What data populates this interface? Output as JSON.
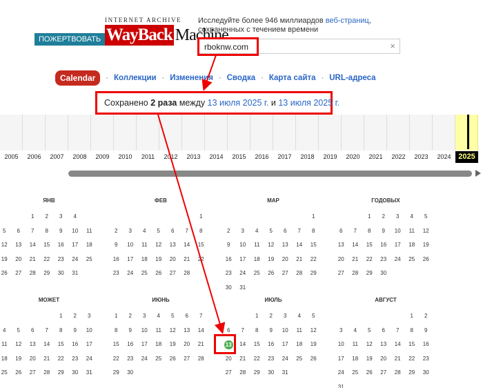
{
  "header": {
    "donate_label": "ПОЖЕРТВОВАТЬ",
    "logo_top": "INTERNET ARCHIVE",
    "logo_way": "WayBack",
    "logo_machine": "Machine",
    "tagline_pre": "Исследуйте более 946 миллиардов ",
    "tagline_link": "веб-страниц",
    "tagline_post": ", сохраненных с течением времени",
    "search_value": "rboknw.com",
    "clear_icon": "×"
  },
  "nav": {
    "calendar": "Calendar",
    "items": [
      "Коллекции",
      "Изменения",
      "Сводка",
      "Карта сайта",
      "URL-адреса"
    ],
    "separator": "·"
  },
  "saved": {
    "prefix": "Сохранено ",
    "count": "2 раза",
    "between": " между ",
    "date_from": "13 июля 2025 г.",
    "and": " и ",
    "date_to": "13 июля 2025 г."
  },
  "timeline": {
    "years": [
      "2005",
      "2006",
      "2007",
      "2008",
      "2009",
      "2010",
      "2011",
      "2012",
      "2013",
      "2014",
      "2015",
      "2016",
      "2017",
      "2018",
      "2019",
      "2020",
      "2021",
      "2022",
      "2023",
      "2024",
      "2025"
    ],
    "current_year": "2025"
  },
  "calendar": {
    "months": [
      {
        "name": "ЯНВ",
        "weeks": [
          [
            "",
            "",
            "1",
            "2",
            "3",
            "4",
            ""
          ],
          [
            "5",
            "6",
            "7",
            "8",
            "9",
            "10",
            "11"
          ],
          [
            "12",
            "13",
            "14",
            "15",
            "16",
            "17",
            "18"
          ],
          [
            "19",
            "20",
            "21",
            "22",
            "23",
            "24",
            "25"
          ],
          [
            "26",
            "27",
            "28",
            "29",
            "30",
            "31",
            ""
          ]
        ]
      },
      {
        "name": "ФЕВ",
        "weeks": [
          [
            "",
            "",
            "",
            "",
            "",
            "",
            "1"
          ],
          [
            "2",
            "3",
            "4",
            "5",
            "6",
            "7",
            "8"
          ],
          [
            "9",
            "10",
            "11",
            "12",
            "13",
            "14",
            "15"
          ],
          [
            "16",
            "17",
            "18",
            "19",
            "20",
            "21",
            "22"
          ],
          [
            "23",
            "24",
            "25",
            "26",
            "27",
            "28",
            ""
          ]
        ]
      },
      {
        "name": "МАР",
        "weeks": [
          [
            "",
            "",
            "",
            "",
            "",
            "",
            "1"
          ],
          [
            "2",
            "3",
            "4",
            "5",
            "6",
            "7",
            "8"
          ],
          [
            "9",
            "10",
            "11",
            "12",
            "13",
            "14",
            "15"
          ],
          [
            "16",
            "17",
            "18",
            "19",
            "20",
            "21",
            "22"
          ],
          [
            "23",
            "24",
            "25",
            "26",
            "27",
            "28",
            "29"
          ],
          [
            "30",
            "31",
            "",
            "",
            "",
            "",
            ""
          ]
        ]
      },
      {
        "name": "ГОДОВЫХ",
        "weeks": [
          [
            "",
            "",
            "1",
            "2",
            "3",
            "4",
            "5"
          ],
          [
            "6",
            "7",
            "8",
            "9",
            "10",
            "11",
            "12"
          ],
          [
            "13",
            "14",
            "15",
            "16",
            "17",
            "18",
            "19"
          ],
          [
            "20",
            "21",
            "22",
            "23",
            "24",
            "25",
            "26"
          ],
          [
            "27",
            "28",
            "29",
            "30",
            "",
            "",
            ""
          ]
        ]
      },
      {
        "name": "МОЖЕТ",
        "weeks": [
          [
            "",
            "",
            "",
            "",
            "1",
            "2",
            "3"
          ],
          [
            "4",
            "5",
            "6",
            "7",
            "8",
            "9",
            "10"
          ],
          [
            "11",
            "12",
            "13",
            "14",
            "15",
            "16",
            "17"
          ],
          [
            "18",
            "19",
            "20",
            "21",
            "22",
            "23",
            "24"
          ],
          [
            "25",
            "26",
            "27",
            "28",
            "29",
            "30",
            "31"
          ]
        ]
      },
      {
        "name": "ИЮНЬ",
        "weeks": [
          [
            "1",
            "2",
            "3",
            "4",
            "5",
            "6",
            "7"
          ],
          [
            "8",
            "9",
            "10",
            "11",
            "12",
            "13",
            "14"
          ],
          [
            "15",
            "16",
            "17",
            "18",
            "19",
            "20",
            "21"
          ],
          [
            "22",
            "23",
            "24",
            "25",
            "26",
            "27",
            "28"
          ],
          [
            "29",
            "30",
            "",
            "",
            "",
            "",
            ""
          ]
        ]
      },
      {
        "name": "ИЮЛЬ",
        "weeks": [
          [
            "",
            "",
            "1",
            "2",
            "3",
            "4",
            "5"
          ],
          [
            "6",
            "7",
            "8",
            "9",
            "10",
            "11",
            "12"
          ],
          [
            "13",
            "14",
            "15",
            "16",
            "17",
            "18",
            "19"
          ],
          [
            "20",
            "21",
            "22",
            "23",
            "24",
            "25",
            "26"
          ],
          [
            "27",
            "28",
            "29",
            "30",
            "31",
            "",
            ""
          ]
        ]
      },
      {
        "name": "АВГУСТ",
        "weeks": [
          [
            "",
            "",
            "",
            "",
            "",
            "1",
            "2"
          ],
          [
            "3",
            "4",
            "5",
            "6",
            "7",
            "8",
            "9"
          ],
          [
            "10",
            "11",
            "12",
            "13",
            "14",
            "15",
            "16"
          ],
          [
            "17",
            "18",
            "19",
            "20",
            "21",
            "22",
            "23"
          ],
          [
            "24",
            "25",
            "26",
            "27",
            "28",
            "29",
            "30"
          ],
          [
            "31",
            "",
            "",
            "",
            "",
            "",
            ""
          ]
        ]
      }
    ],
    "captured_month": "ИЮЛЬ",
    "captured_day": "13",
    "capture_color": "#4caf50"
  },
  "colors": {
    "highlight": "#ee0000",
    "link": "#2a66c7",
    "calendar_button": "#c52a1f"
  }
}
